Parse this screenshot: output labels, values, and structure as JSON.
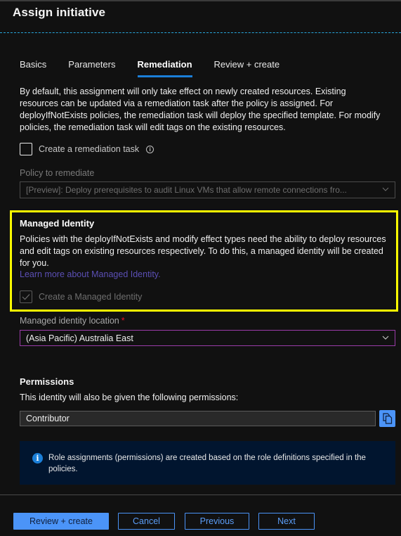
{
  "window": {
    "title": "Assign initiative"
  },
  "tabs": [
    {
      "label": "Basics",
      "active": false
    },
    {
      "label": "Parameters",
      "active": false
    },
    {
      "label": "Remediation",
      "active": true
    },
    {
      "label": "Review + create",
      "active": false
    }
  ],
  "remediation": {
    "intro": "By default, this assignment will only take effect on newly created resources. Existing resources can be updated via a remediation task after the policy is assigned. For deployIfNotExists policies, the remediation task will deploy the specified template. For modify policies, the remediation task will edit tags on the existing resources.",
    "create_task_label": "Create a remediation task",
    "create_task_checked": false,
    "info_icon": "info-icon",
    "policy_label": "Policy to remediate",
    "policy_value": "[Preview]: Deploy prerequisites to audit Linux VMs that allow remote connections fro..."
  },
  "managed_identity": {
    "title": "Managed Identity",
    "description": "Policies with the deployIfNotExists and modify effect types need the ability to deploy resources and edit tags on existing resources respectively. To do this, a managed identity will be created for you.",
    "link": "Learn more about Managed Identity.",
    "create_label": "Create a Managed Identity",
    "create_checked": true,
    "highlight_color": "#ffff00"
  },
  "location": {
    "label": "Managed identity location",
    "required_marker": "*",
    "value": "(Asia Pacific) Australia East"
  },
  "permissions": {
    "title": "Permissions",
    "description": "This identity will also be given the following permissions:",
    "value": "Contributor",
    "copy_icon": "copy-icon"
  },
  "info_banner": {
    "icon": "i",
    "text": "Role assignments (permissions) are created based on the role definitions specified in the policies."
  },
  "footer": {
    "review_create": "Review + create",
    "cancel": "Cancel",
    "previous": "Previous",
    "next": "Next"
  },
  "colors": {
    "accent": "#4b94f8",
    "tab_underline": "#1b7fd8",
    "link": "#5b4fb5",
    "required": "#e81123",
    "banner_bg": "#01152f"
  }
}
